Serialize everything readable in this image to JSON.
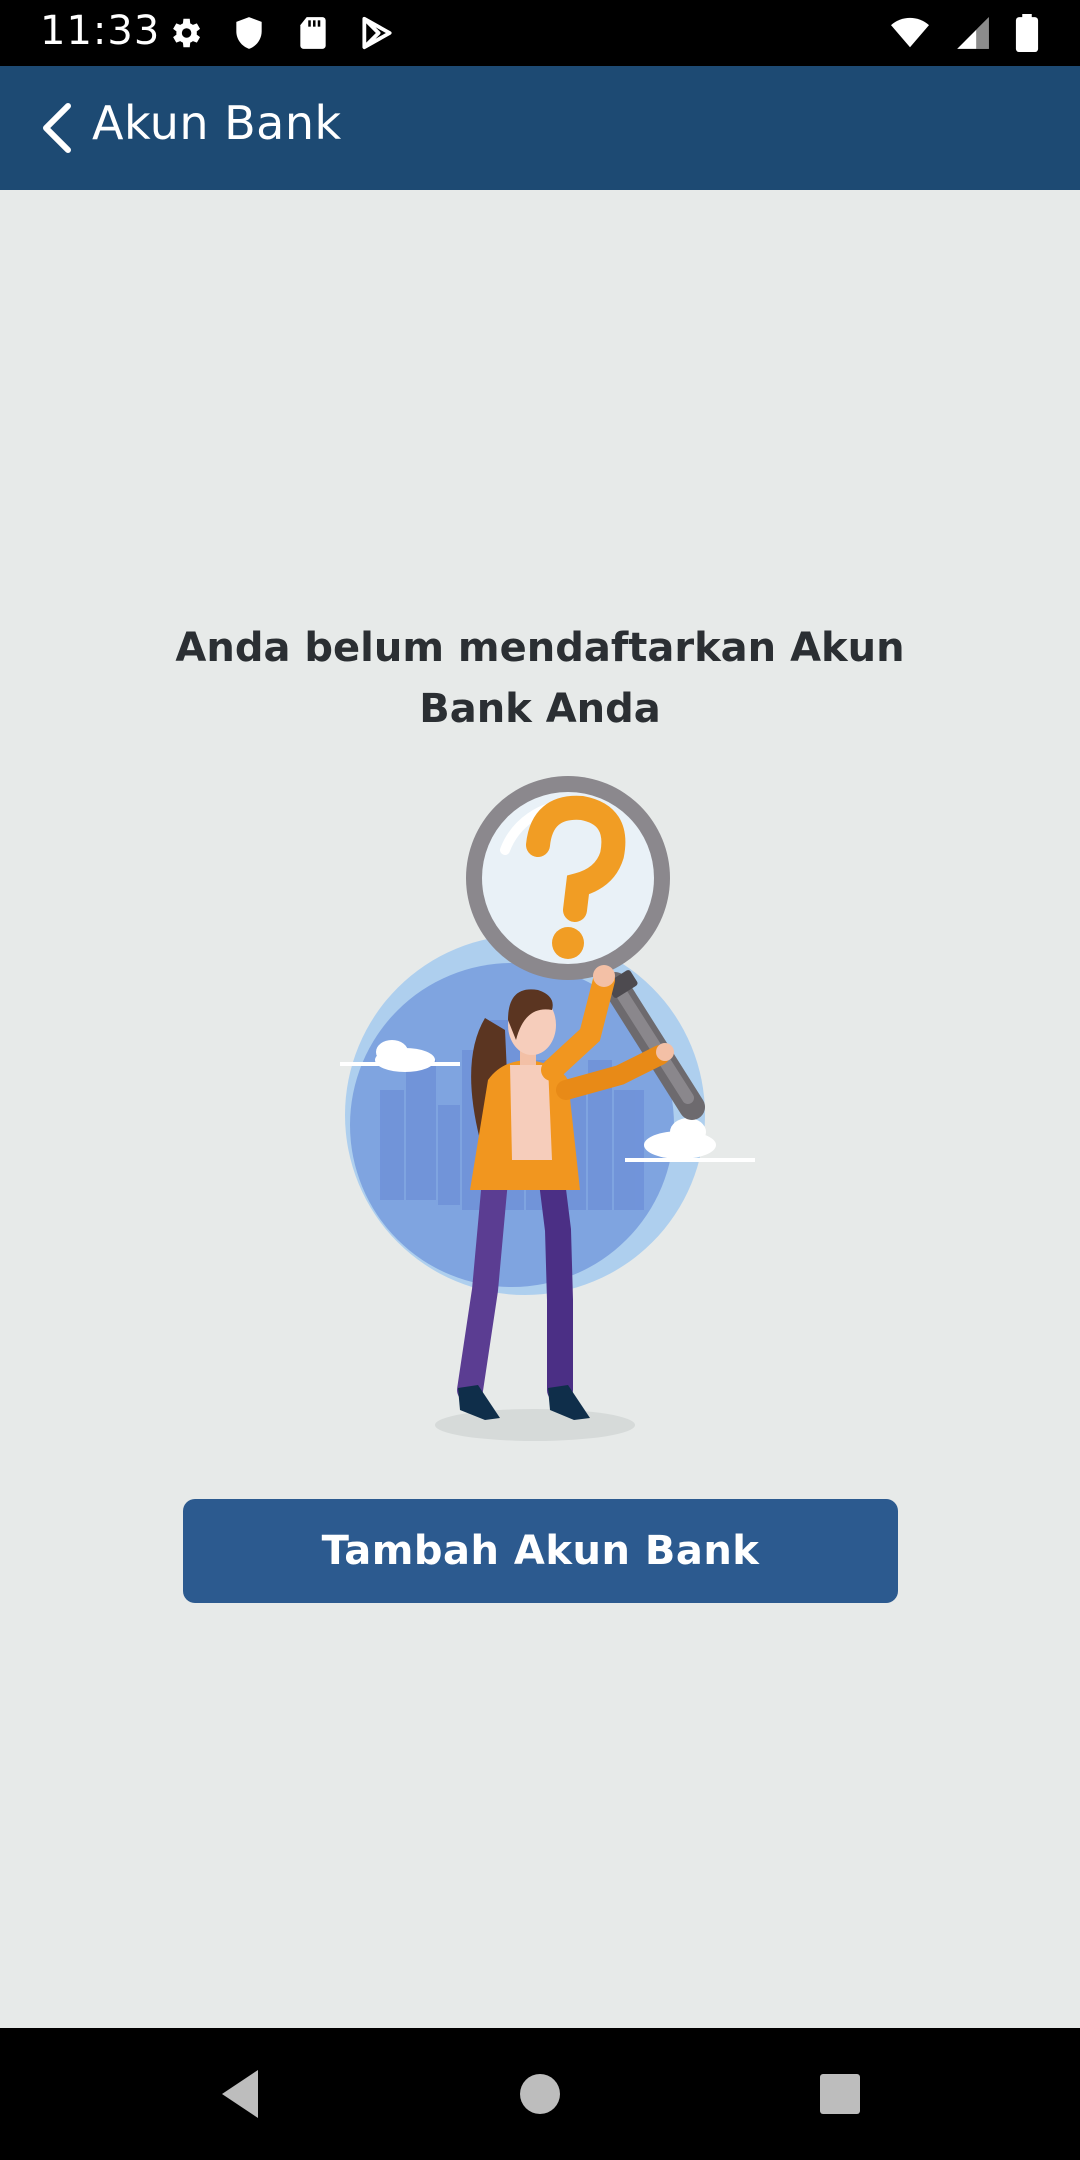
{
  "status_bar": {
    "time": "11:33",
    "left_icons": [
      "gear-icon",
      "shield-icon",
      "sd-card-icon",
      "play-store-icon"
    ],
    "right_icons": [
      "wifi-icon",
      "signal-icon",
      "battery-icon"
    ]
  },
  "app_bar": {
    "title": "Akun Bank",
    "back_icon": "chevron-left-icon",
    "background": "#1d4a73"
  },
  "empty_state": {
    "message": "Anda belum mendaftarkan Akun Bank Anda",
    "illustration": "woman-with-magnifier-question-illustration"
  },
  "actions": {
    "add_bank_label": "Tambah Akun Bank",
    "button_color": "#2c5a8f"
  },
  "nav_bar": {
    "buttons": [
      "back-triangle-icon",
      "home-circle-icon",
      "recents-square-icon"
    ]
  }
}
